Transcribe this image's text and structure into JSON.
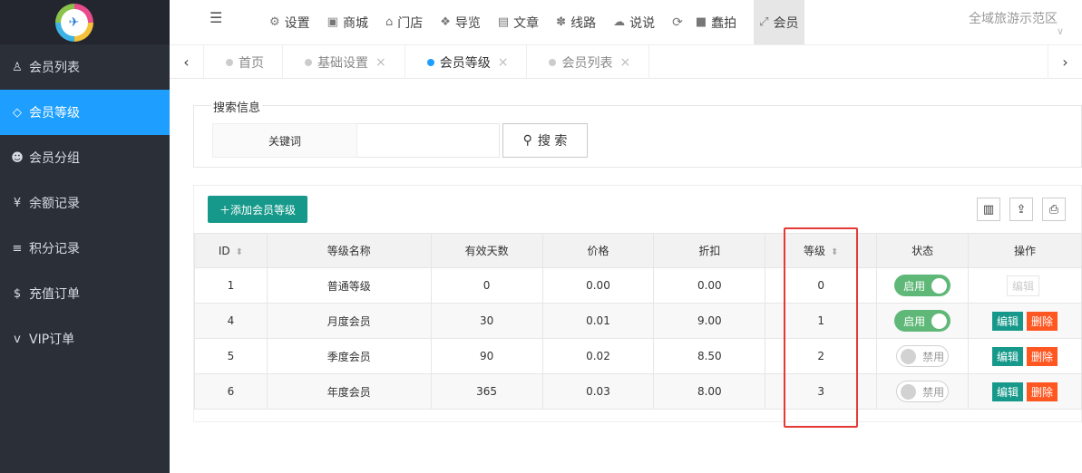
{
  "sidebar": {
    "logo_icon": "logo-icon",
    "items": [
      {
        "label": "会员列表",
        "icon": "user-icon",
        "glyph": "♙"
      },
      {
        "label": "会员等级",
        "icon": "diamond-icon",
        "glyph": "◇"
      },
      {
        "label": "会员分组",
        "icon": "users-icon",
        "glyph": "☻"
      },
      {
        "label": "余额记录",
        "icon": "yen-icon",
        "glyph": "¥"
      },
      {
        "label": "积分记录",
        "icon": "database-icon",
        "glyph": "≡"
      },
      {
        "label": "充值订单",
        "icon": "dollar-icon",
        "glyph": "$"
      },
      {
        "label": "VIP订单",
        "icon": "vimeo-icon",
        "glyph": "v"
      }
    ],
    "active_index": 1
  },
  "topnav": {
    "items": [
      {
        "label": "设置",
        "icon": "gears-icon",
        "glyph": "⚙"
      },
      {
        "label": "商城",
        "icon": "shop-icon",
        "glyph": "▣"
      },
      {
        "label": "门店",
        "icon": "bank-icon",
        "glyph": "⌂"
      },
      {
        "label": "导览",
        "icon": "cubes-icon",
        "glyph": "❖"
      },
      {
        "label": "文章",
        "icon": "newspaper-icon",
        "glyph": "▤"
      },
      {
        "label": "线路",
        "icon": "leaf-icon",
        "glyph": "✽"
      },
      {
        "label": "说说",
        "icon": "wechat-icon",
        "glyph": "☁"
      },
      {
        "label": "蠢拍",
        "icon": "video-icon",
        "glyph": "■"
      },
      {
        "label": "会员",
        "icon": "expand-user-icon",
        "glyph": "⤢"
      }
    ],
    "active_index": 8,
    "site_name": "全域旅游示范区"
  },
  "tabs": [
    {
      "label": "首页",
      "closable": false
    },
    {
      "label": "基础设置",
      "closable": true
    },
    {
      "label": "会员等级",
      "closable": true
    },
    {
      "label": "会员列表",
      "closable": true
    }
  ],
  "active_tab": 2,
  "search": {
    "legend": "搜索信息",
    "keyword_label": "关键词",
    "keyword_value": "",
    "button_label": "搜 索"
  },
  "toolbar": {
    "add_label": "＋添加会员等级"
  },
  "table": {
    "headers": [
      "ID",
      "等级名称",
      "有效天数",
      "价格",
      "折扣",
      "等级",
      "状态",
      "操作"
    ],
    "rows": [
      {
        "id": "1",
        "name": "普通等级",
        "days": "0",
        "price": "0.00",
        "discount": "0.00",
        "level": "0",
        "status": "启用",
        "enabled": true,
        "editable": false
      },
      {
        "id": "4",
        "name": "月度会员",
        "days": "30",
        "price": "0.01",
        "discount": "9.00",
        "level": "1",
        "status": "启用",
        "enabled": true,
        "editable": true
      },
      {
        "id": "5",
        "name": "季度会员",
        "days": "90",
        "price": "0.02",
        "discount": "8.50",
        "level": "2",
        "status": "禁用",
        "enabled": false,
        "editable": true
      },
      {
        "id": "6",
        "name": "年度会员",
        "days": "365",
        "price": "0.03",
        "discount": "8.00",
        "level": "3",
        "status": "禁用",
        "enabled": false,
        "editable": true
      }
    ],
    "edit_label": "编辑",
    "delete_label": "删除"
  },
  "colors": {
    "sidebar_bg": "#2b2f37",
    "active_blue": "#1e9fff",
    "primary_green": "#16998a",
    "switch_on": "#5fb878",
    "danger": "#ff5722",
    "highlight_red": "#e53935"
  }
}
